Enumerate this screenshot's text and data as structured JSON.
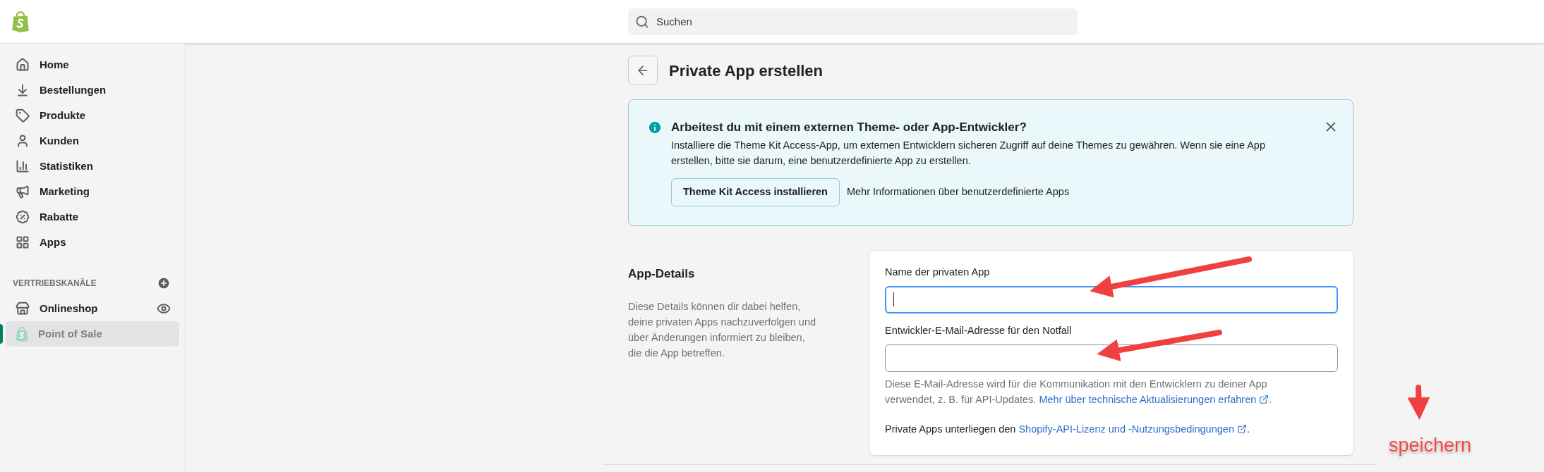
{
  "top_bar": {
    "search": {
      "placeholder": "Suchen"
    }
  },
  "sidebar": {
    "items": [
      {
        "label": "Home",
        "selected": false
      },
      {
        "label": "Bestellungen",
        "selected": false
      },
      {
        "label": "Produkte",
        "selected": false
      },
      {
        "label": "Kunden",
        "selected": false
      },
      {
        "label": "Statistiken",
        "selected": false
      },
      {
        "label": "Marketing",
        "selected": false
      },
      {
        "label": "Rabatte",
        "selected": false
      },
      {
        "label": "Apps",
        "selected": false
      }
    ],
    "channels_heading": "VERTRIEBSKANÄLE",
    "channels": [
      {
        "label": "Onlineshop",
        "selected": false,
        "disabled": false
      },
      {
        "label": "Point of Sale",
        "selected": true,
        "disabled": true
      }
    ]
  },
  "page": {
    "title": "Private App erstellen"
  },
  "banner": {
    "title": "Arbeitest du mit einem externen Theme- oder App-Entwickler?",
    "text": "Installiere die Theme Kit Access-App, um externen Entwicklern sicheren Zugriff auf deine Themes zu gewähren. Wenn sie eine App erstellen, bitte sie darum, eine benutzerdefinierte App zu erstellen.",
    "button": "Theme Kit Access installieren",
    "link": "Mehr Informationen über benutzerdefinierte Apps"
  },
  "app_details": {
    "heading": "App-Details",
    "description": "Diese Details können dir dabei helfen, deine privaten Apps nachzuverfolgen und über Änderungen informiert zu bleiben, die die App betreffen.",
    "fields": [
      {
        "label": "Name der privaten App",
        "focused": true
      },
      {
        "label": "Entwickler-E-Mail-Adresse für den Notfall",
        "focused": false
      }
    ],
    "help_text": "Diese E-Mail-Adresse wird für die Kommunikation mit den Entwicklern zu deiner App verwendet, z. B. für API-Updates.",
    "help_link": "Mehr über technische Aktualisierungen erfahren",
    "help_end": ".",
    "license_text": "Private Apps unterliegen den",
    "license_link": "Shopify-API-Lizenz und -Nutzungsbedingungen",
    "license_end": "."
  },
  "annotation": {
    "text": "speichern"
  }
}
